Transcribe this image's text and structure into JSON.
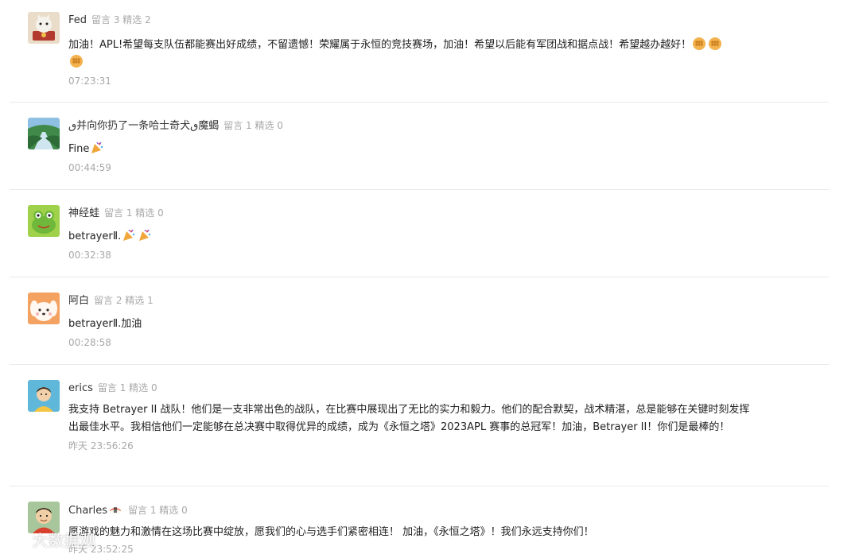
{
  "comments": [
    {
      "nickname": "Fed",
      "stats": "留言 3 精选 2",
      "content": "加油！APL!希望每支队伍都能赛出好成绩，不留遗憾！荣耀属于永恒的竞技赛场，加油！希望以后能有军团战和据点战！希望越办越好！",
      "time": "07:23:31"
    },
    {
      "nickname": "ٯ并向你扔了一条哈士奇犬ٯ魔蝎",
      "stats": "留言 1 精选 0",
      "content": "Fine",
      "time": "00:44:59"
    },
    {
      "nickname": "神经蛙",
      "stats": "留言 1 精选 0",
      "content": "betrayerⅡ.",
      "time": "00:32:38"
    },
    {
      "nickname": "阿白",
      "stats": "留言 2 精选 1",
      "content": "betrayerⅡ.加油",
      "time": "00:28:58"
    },
    {
      "nickname": "erics",
      "stats": "留言 1 精选 0",
      "content": "我支持 Betrayer II 战队！他们是一支非常出色的战队，在比赛中展现出了无比的实力和毅力。他们的配合默契，战术精湛，总是能够在关键时刻发挥出最佳水平。我相信他们一定能够在总决赛中取得优异的成绩，成为《永恒之塔》2023APL 赛事的总冠军！加油，Betrayer II！你们是最棒的！",
      "time": "昨天 23:56:26"
    },
    {
      "nickname": "Charles",
      "stats": "留言 1 精选 0",
      "content": "愿游戏的魅力和激情在这场比赛中绽放，愿我们的心与选手们紧密相连！  加油，《永恒之塔》！我们永远支持你们！",
      "time": "昨天 23:52:25"
    }
  ],
  "watermark": "大数据观",
  "emoji": {
    "fist": "fist-emoji",
    "party": "party-popper-emoji",
    "sushi": "sushi-emoji"
  }
}
